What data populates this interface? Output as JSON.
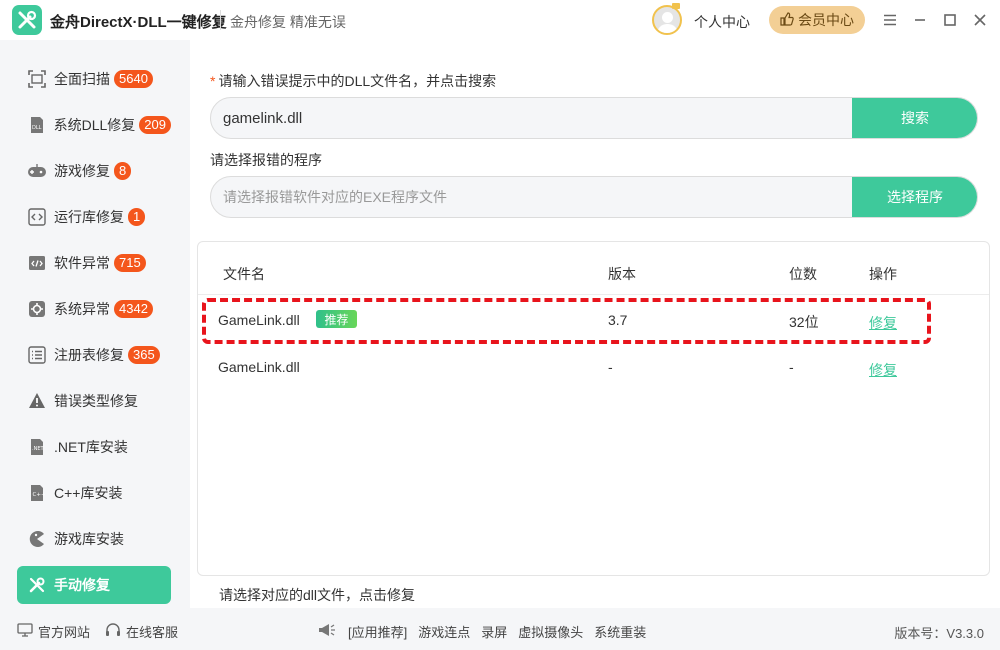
{
  "app": {
    "title": "金舟DirectX·DLL一键修复",
    "subtitle": "金舟修复 精准无误",
    "personal_center": "个人中心",
    "vip_center": "会员中心"
  },
  "sidebar": {
    "items": [
      {
        "label": "全面扫描",
        "badge": "5640",
        "icon": "scan-icon"
      },
      {
        "label": "系统DLL修复",
        "badge": "209",
        "icon": "dll-icon"
      },
      {
        "label": "游戏修复",
        "badge": "8",
        "icon": "gamepad-icon"
      },
      {
        "label": "运行库修复",
        "badge": "1",
        "icon": "code-icon"
      },
      {
        "label": "软件异常",
        "badge": "715",
        "icon": "code-window-icon"
      },
      {
        "label": "系统异常",
        "badge": "4342",
        "icon": "gear-icon"
      },
      {
        "label": "注册表修复",
        "badge": "365",
        "icon": "list-icon"
      },
      {
        "label": "错误类型修复",
        "badge": "",
        "icon": "warning-icon"
      },
      {
        "label": ".NET库安装",
        "badge": "",
        "icon": "net-icon"
      },
      {
        "label": "C++库安装",
        "badge": "",
        "icon": "cpp-icon"
      },
      {
        "label": "游戏库安装",
        "badge": "",
        "icon": "pacman-icon"
      },
      {
        "label": "手动修复",
        "badge": "",
        "icon": "wrench-icon"
      }
    ]
  },
  "form": {
    "dll_label": "请输入错误提示中的DLL文件名，并点击搜索",
    "dll_required_mark": "*",
    "dll_value": "gamelink.dll",
    "search_button": "搜索",
    "program_label": "请选择报错的程序",
    "program_placeholder": "请选择报错软件对应的EXE程序文件",
    "program_button": "选择程序"
  },
  "table": {
    "headers": {
      "filename": "文件名",
      "version": "版本",
      "bits": "位数",
      "action": "操作"
    },
    "rows": [
      {
        "filename": "GameLink.dll",
        "recommend": "推荐",
        "version": "3.7",
        "bits": "32位",
        "action": "修复"
      },
      {
        "filename": "GameLink.dll",
        "recommend": "",
        "version": "-",
        "bits": "-",
        "action": "修复"
      }
    ]
  },
  "hint": "请选择对应的dll文件，点击修复",
  "footer": {
    "official_site": "官方网站",
    "online_service": "在线客服",
    "app_recommend": "[应用推荐]",
    "links": [
      "游戏连点",
      "录屏",
      "虚拟摄像头",
      "系统重装"
    ],
    "version": "版本号：V3.3.0"
  },
  "colors": {
    "accent": "#3ec99b",
    "badge": "#f4561c",
    "highlight": "#e8141c",
    "vip": "#f3cf95"
  }
}
